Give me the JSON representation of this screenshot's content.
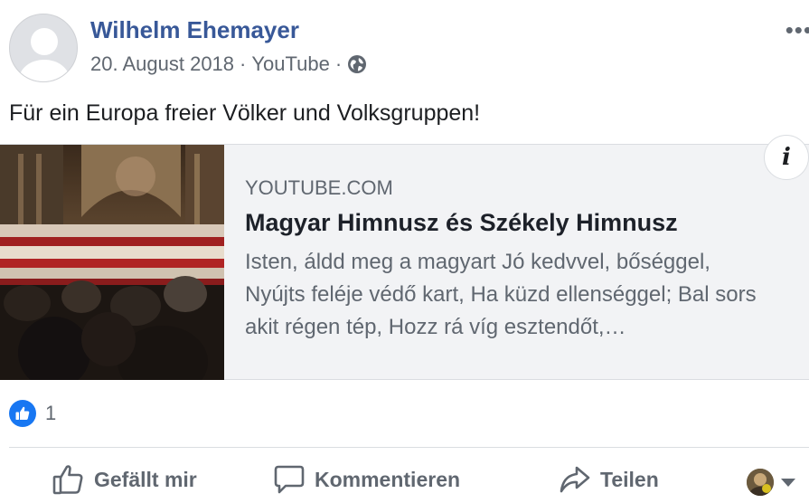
{
  "post": {
    "author": "Wilhelm Ehemayer",
    "date": "20. August 2018",
    "separator1": "·",
    "source": "YouTube",
    "separator2": "·",
    "privacy_icon": "globe-icon",
    "more_label": "•••",
    "text": "Für ein Europa freier Völker und Volksgruppen!"
  },
  "link_preview": {
    "domain": "YOUTUBE.COM",
    "title": "Magyar Himnusz és Székely Himnusz",
    "description_lines": [
      "Isten, áldd meg a magyart Jó kedvvel, bőséggel,",
      "Nyújts feléje védő kart, Ha küzd ellenséggel; Bal sors",
      "akit régen tép, Hozz rá víg esztendőt,…"
    ],
    "info_label": "i"
  },
  "reactions": {
    "icon": "like-icon",
    "count": "1"
  },
  "actions": {
    "like": "Gefällt mir",
    "comment": "Kommentieren",
    "share": "Teilen"
  },
  "colors": {
    "author_link": "#385898",
    "like_blue": "#1877f2",
    "secondary_text": "#606770",
    "card_bg": "#f2f3f5"
  }
}
